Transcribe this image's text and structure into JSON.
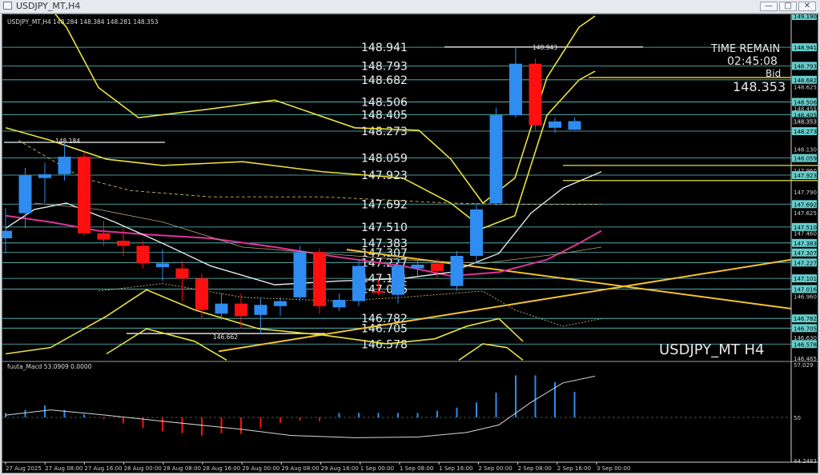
{
  "window": {
    "title": "USDJPY_MT,H4",
    "min_label": "—",
    "max_label": "□",
    "close_label": "✕"
  },
  "main_chart": {
    "header": "USDJPY_MT,H4  148.284 148.384 148.281 148.353",
    "watermark": "USDJPY_MT H4",
    "time_remain_label": "TIME REMAIN",
    "time_remain_value": "02:45:08",
    "bid_label": "Bid",
    "bid_value": "148.353",
    "price_axis_ticks": [
      "149.190",
      "148.941",
      "148.793",
      "148.682",
      "148.625",
      "148.506",
      "148.455",
      "148.405",
      "148.353",
      "148.273",
      "148.130",
      "148.059",
      "147.960",
      "147.923",
      "147.790",
      "147.692",
      "147.625",
      "147.510",
      "147.460",
      "147.383",
      "147.307",
      "147.227",
      "147.101",
      "147.016",
      "146.960",
      "146.782",
      "146.705",
      "146.630",
      "146.578",
      "146.465"
    ],
    "level_labels": [
      "148.941",
      "148.793",
      "148.682",
      "148.506",
      "148.405",
      "148.273",
      "148.059",
      "147.923",
      "147.692",
      "147.510",
      "147.383",
      "147.307",
      "147.227",
      "147.101",
      "147.016",
      "146.782",
      "146.705",
      "146.578"
    ],
    "high_annotation": "148.943",
    "low_annotation": "146.662",
    "left_annotation": "148.184"
  },
  "indicator": {
    "header": "fuuta_Macd 53.0909  0.0000",
    "axis_ticks": [
      "57.029",
      "50",
      "44.2483"
    ]
  },
  "time_axis": [
    "27 Aug 2025",
    "27 Aug 08:00",
    "27 Aug 16:00",
    "28 Aug 00:00",
    "28 Aug 08:00",
    "28 Aug 16:00",
    "29 Aug 00:00",
    "29 Aug 08:00",
    "29 Aug 16:00",
    "1 Sep 00:00",
    "1 Sep 08:00",
    "1 Sep 16:00",
    "2 Sep 00:00",
    "2 Sep 08:00",
    "2 Sep 16:00",
    "3 Sep 00:00"
  ],
  "colors": {
    "bull": "#2f8cf0",
    "bear": "#ff1010",
    "level_line": "#5ec8c8",
    "band": "#e9e23c",
    "ma_pink": "#e0339a",
    "ma_white": "#e8e8e8",
    "trend": "#f2c230",
    "tag_bg": "#66cccc"
  },
  "chart_data": {
    "type": "candlestick",
    "symbol": "USDJPY_MT",
    "timeframe": "H4",
    "ylim": [
      146.465,
      149.19
    ],
    "candles": [
      {
        "o": 147.42,
        "h": 147.66,
        "l": 147.3,
        "c": 147.48
      },
      {
        "o": 147.62,
        "h": 147.98,
        "l": 147.5,
        "c": 147.92
      },
      {
        "o": 147.9,
        "h": 148.02,
        "l": 147.7,
        "c": 147.93
      },
      {
        "o": 147.93,
        "h": 148.184,
        "l": 147.88,
        "c": 148.07
      },
      {
        "o": 148.07,
        "h": 148.1,
        "l": 147.44,
        "c": 147.46
      },
      {
        "o": 147.46,
        "h": 147.56,
        "l": 147.36,
        "c": 147.41
      },
      {
        "o": 147.4,
        "h": 147.5,
        "l": 147.28,
        "c": 147.36
      },
      {
        "o": 147.36,
        "h": 147.4,
        "l": 147.18,
        "c": 147.22
      },
      {
        "o": 147.19,
        "h": 147.33,
        "l": 147.08,
        "c": 147.22
      },
      {
        "o": 147.18,
        "h": 147.24,
        "l": 146.92,
        "c": 147.1
      },
      {
        "o": 147.1,
        "h": 147.14,
        "l": 146.78,
        "c": 146.85
      },
      {
        "o": 146.82,
        "h": 146.98,
        "l": 146.77,
        "c": 146.9
      },
      {
        "o": 146.9,
        "h": 146.98,
        "l": 146.7,
        "c": 146.8
      },
      {
        "o": 146.81,
        "h": 146.94,
        "l": 146.662,
        "c": 146.89
      },
      {
        "o": 146.88,
        "h": 146.95,
        "l": 146.8,
        "c": 146.92
      },
      {
        "o": 146.95,
        "h": 147.36,
        "l": 146.92,
        "c": 147.31
      },
      {
        "o": 147.31,
        "h": 147.34,
        "l": 146.82,
        "c": 146.88
      },
      {
        "o": 146.87,
        "h": 146.98,
        "l": 146.84,
        "c": 146.93
      },
      {
        "o": 146.92,
        "h": 147.25,
        "l": 146.88,
        "c": 147.2
      },
      {
        "o": 147.0,
        "h": 147.1,
        "l": 146.97,
        "c": 146.99
      },
      {
        "o": 146.97,
        "h": 147.28,
        "l": 146.9,
        "c": 147.2
      },
      {
        "o": 147.18,
        "h": 147.26,
        "l": 147.12,
        "c": 147.21
      },
      {
        "o": 147.22,
        "h": 147.26,
        "l": 147.1,
        "c": 147.16
      },
      {
        "o": 147.04,
        "h": 147.32,
        "l": 147.0,
        "c": 147.28
      },
      {
        "o": 147.28,
        "h": 147.7,
        "l": 147.22,
        "c": 147.65
      },
      {
        "o": 147.7,
        "h": 148.46,
        "l": 147.68,
        "c": 148.4
      },
      {
        "o": 148.4,
        "h": 148.943,
        "l": 148.38,
        "c": 148.81
      },
      {
        "o": 148.81,
        "h": 148.85,
        "l": 148.28,
        "c": 148.32
      },
      {
        "o": 148.3,
        "h": 148.38,
        "l": 148.26,
        "c": 148.35
      },
      {
        "o": 148.284,
        "h": 148.384,
        "l": 148.281,
        "c": 148.353
      }
    ],
    "macd_histogram": [
      50.6,
      51.0,
      51.6,
      51.0,
      50.4,
      49.8,
      49.2,
      48.6,
      48.2,
      47.9,
      47.6,
      47.9,
      47.8,
      48.6,
      49.3,
      49.6,
      49.5,
      50.6,
      50.6,
      50.6,
      50.6,
      50.6,
      50.9,
      51.3,
      52.0,
      53.3,
      55.6,
      55.6,
      54.7,
      53.4
    ],
    "ind_ylim": [
      44.2483,
      57.029
    ]
  }
}
